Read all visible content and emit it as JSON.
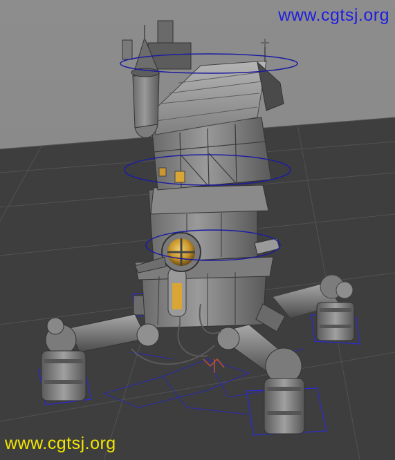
{
  "viewport": {
    "background_top": "#8d8d8d",
    "floor_color": "#3f3f3f",
    "grid_color": "#555555",
    "wireframe_color": "#1c1ca0",
    "model_color": "#8b8b8b",
    "window_glow": "#d9a635",
    "pivot_color": "#c05030"
  },
  "watermarks": {
    "top": {
      "text": "www.cgtsj.org",
      "color": "#1e1ee0"
    },
    "bottom": {
      "text": "www.cgtsj.org",
      "color": "#f2e600"
    }
  }
}
